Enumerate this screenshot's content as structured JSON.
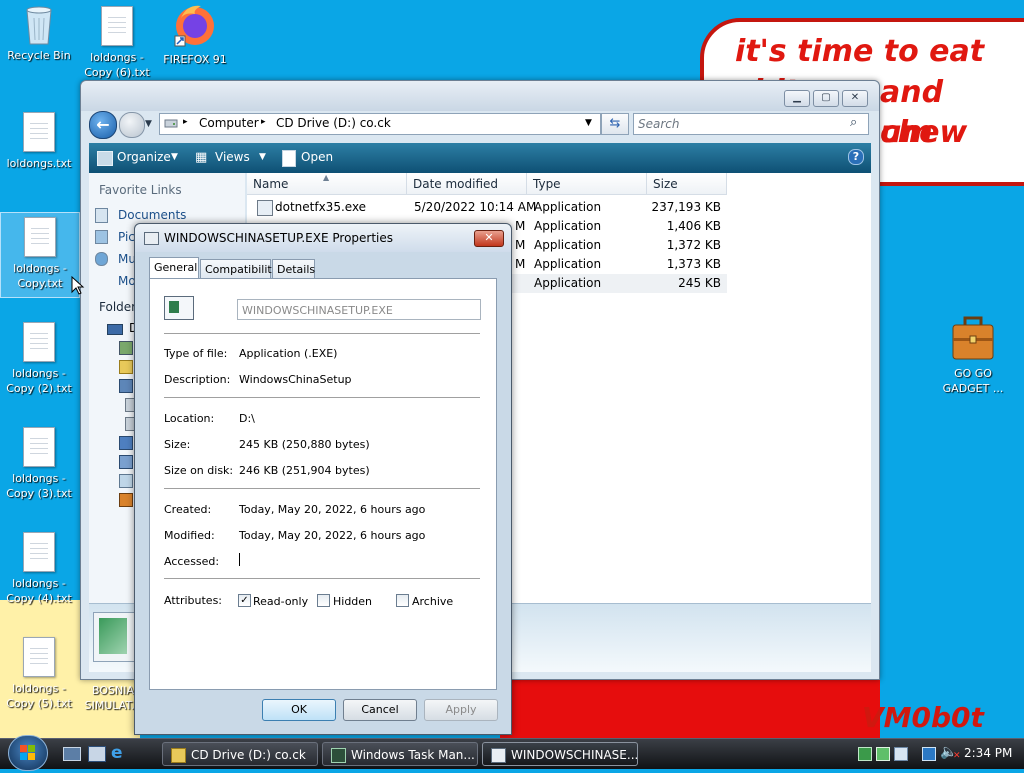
{
  "wallpaper": {
    "bubble_lines": [
      "it's time to eat shit",
      "and chew",
      "um"
    ],
    "signature": "VM0b0t"
  },
  "desktop": {
    "icons": [
      {
        "label": "Recycle Bin",
        "icon": "recycle-bin-icon"
      },
      {
        "label": "loldongs - Copy (6).txt",
        "icon": "text-file-icon"
      },
      {
        "label": "FIREFOX 91",
        "icon": "firefox-icon"
      },
      {
        "label": "loldongs.txt",
        "icon": "text-file-icon"
      },
      {
        "label": "loldongs - Copy.txt",
        "icon": "text-file-icon"
      },
      {
        "label": "loldongs - Copy (2).txt",
        "icon": "text-file-icon"
      },
      {
        "label": "loldongs - Copy (3).txt",
        "icon": "text-file-icon"
      },
      {
        "label": "loldongs - Copy (4).txt",
        "icon": "text-file-icon"
      },
      {
        "label": "loldongs - Copy (5).txt",
        "icon": "text-file-icon"
      },
      {
        "label": "BOSNIA SIMULAT...",
        "icon": "application-icon"
      },
      {
        "label": "GO GO GADGET ...",
        "icon": "briefcase-icon"
      }
    ]
  },
  "explorer": {
    "breadcrumb": [
      "Computer",
      "CD Drive (D:) co.ck"
    ],
    "search_placeholder": "Search",
    "commands": {
      "organize": "Organize",
      "views": "Views",
      "open": "Open"
    },
    "nav": {
      "favorite_links_header": "Favorite Links",
      "links": [
        "Documents",
        "Pic",
        "Mu",
        "Mo"
      ],
      "folders_header": "Folders",
      "tree_first": "D"
    },
    "columns": {
      "name": "Name",
      "date": "Date modified",
      "type": "Type",
      "size": "Size"
    },
    "rows": [
      {
        "name": "dotnetfx35.exe",
        "date": "5/20/2022 10:14 AM",
        "type": "Application",
        "size": "237,193 KB"
      },
      {
        "name": "",
        "date": "M",
        "type": "Application",
        "size": "1,406 KB"
      },
      {
        "name": "",
        "date": "M",
        "type": "Application",
        "size": "1,372 KB"
      },
      {
        "name": "",
        "date": "M",
        "type": "Application",
        "size": "1,373 KB"
      },
      {
        "name": "",
        "date": "",
        "type": "Application",
        "size": "245 KB"
      }
    ]
  },
  "dialog": {
    "title": "WINDOWSCHINASETUP.EXE Properties",
    "tabs": [
      "General",
      "Compatibility",
      "Details"
    ],
    "filename": "WINDOWSCHINASETUP.EXE",
    "type_of_file_label": "Type of file:",
    "type_of_file": "Application (.EXE)",
    "description_label": "Description:",
    "description": "WindowsChinaSetup",
    "location_label": "Location:",
    "location": "D:\\",
    "size_label": "Size:",
    "size": "245 KB (250,880 bytes)",
    "size_on_disk_label": "Size on disk:",
    "size_on_disk": "246 KB (251,904 bytes)",
    "created_label": "Created:",
    "created": "Today, May 20, 2022, 6 hours ago",
    "modified_label": "Modified:",
    "modified": "Today, May 20, 2022, 6 hours ago",
    "accessed_label": "Accessed:",
    "accessed": "",
    "attributes_label": "Attributes:",
    "readonly": "Read-only",
    "hidden": "Hidden",
    "archive": "Archive",
    "ok": "OK",
    "cancel": "Cancel",
    "apply": "Apply"
  },
  "taskbar": {
    "tasks": [
      "CD Drive (D:) co.ck",
      "Windows Task Man...",
      "WINDOWSCHINASE..."
    ],
    "clock": "2:34 PM"
  }
}
